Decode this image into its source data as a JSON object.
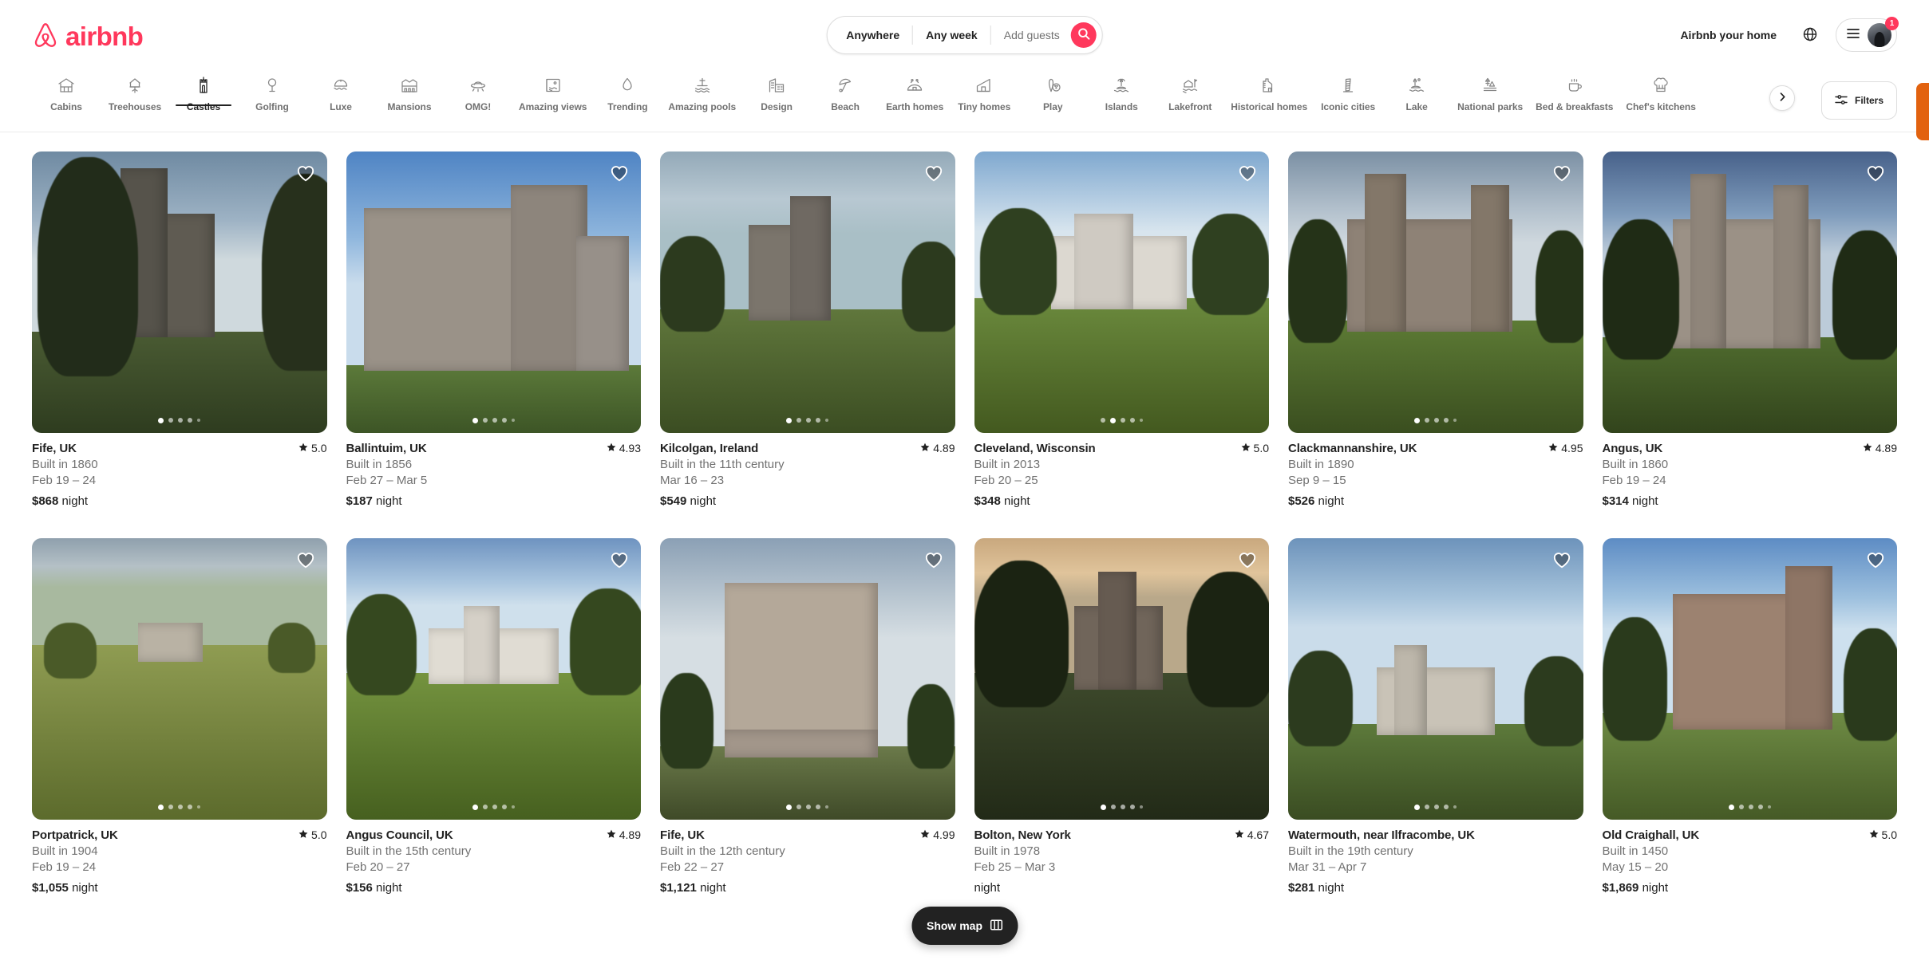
{
  "header": {
    "brand": "airbnb",
    "host_link": "Airbnb your home",
    "globe_icon": "globe-icon",
    "menu_icon": "hamburger-icon",
    "notification_count": "1",
    "search": {
      "location": "Anywhere",
      "dates": "Any week",
      "guests_placeholder": "Add guests",
      "search_icon": "search-icon"
    }
  },
  "categories": {
    "active": "Castles",
    "next_icon": "chevron-right-icon",
    "filters_label": "Filters",
    "filters_icon": "sliders-icon",
    "items": [
      {
        "label": "Cabins",
        "icon": "cabin-icon"
      },
      {
        "label": "Treehouses",
        "icon": "treehouse-icon"
      },
      {
        "label": "Castles",
        "icon": "castle-icon"
      },
      {
        "label": "Golfing",
        "icon": "golf-icon"
      },
      {
        "label": "Luxe",
        "icon": "luxe-cloche-icon"
      },
      {
        "label": "Mansions",
        "icon": "mansion-icon"
      },
      {
        "label": "OMG!",
        "icon": "ufo-icon"
      },
      {
        "label": "Amazing views",
        "icon": "amazing-views-icon"
      },
      {
        "label": "Trending",
        "icon": "flame-icon"
      },
      {
        "label": "Amazing pools",
        "icon": "pool-icon"
      },
      {
        "label": "Design",
        "icon": "design-icon"
      },
      {
        "label": "Beach",
        "icon": "beach-umbrella-icon"
      },
      {
        "label": "Earth homes",
        "icon": "earth-home-icon"
      },
      {
        "label": "Tiny homes",
        "icon": "tiny-home-icon"
      },
      {
        "label": "Play",
        "icon": "bowling-icon"
      },
      {
        "label": "Islands",
        "icon": "island-icon"
      },
      {
        "label": "Lakefront",
        "icon": "lakefront-icon"
      },
      {
        "label": "Historical homes",
        "icon": "historical-home-icon"
      },
      {
        "label": "Iconic cities",
        "icon": "leaning-tower-icon"
      },
      {
        "label": "Lake",
        "icon": "lake-icon"
      },
      {
        "label": "National parks",
        "icon": "national-park-icon"
      },
      {
        "label": "Bed & breakfasts",
        "icon": "coffee-cup-icon"
      },
      {
        "label": "Chef's kitchens",
        "icon": "chef-hat-icon"
      }
    ]
  },
  "listings": [
    {
      "title": "Fife, UK",
      "subtitle": "Built in 1860",
      "dates": "Feb 19 – 24",
      "price": "$868",
      "price_unit": "night",
      "rating": "5.0",
      "dots": 5,
      "active_dot": 0
    },
    {
      "title": "Ballintuim, UK",
      "subtitle": "Built in 1856",
      "dates": "Feb 27 – Mar 5",
      "price": "$187",
      "price_unit": "night",
      "rating": "4.93",
      "dots": 5,
      "active_dot": 0
    },
    {
      "title": "Kilcolgan, Ireland",
      "subtitle": "Built in the 11th century",
      "dates": "Mar 16 – 23",
      "price": "$549",
      "price_unit": "night",
      "rating": "4.89",
      "dots": 5,
      "active_dot": 0
    },
    {
      "title": "Cleveland, Wisconsin",
      "subtitle": "Built in 2013",
      "dates": "Feb 20 – 25",
      "price": "$348",
      "price_unit": "night",
      "rating": "5.0",
      "dots": 5,
      "active_dot": 1
    },
    {
      "title": "Clackmannanshire, UK",
      "subtitle": "Built in 1890",
      "dates": "Sep 9 – 15",
      "price": "$526",
      "price_unit": "night",
      "rating": "4.95",
      "dots": 5,
      "active_dot": 0
    },
    {
      "title": "Angus, UK",
      "subtitle": "Built in 1860",
      "dates": "Feb 19 – 24",
      "price": "$314",
      "price_unit": "night",
      "rating": "4.89",
      "dots": 0,
      "active_dot": 0
    },
    {
      "title": "Portpatrick, UK",
      "subtitle": "Built in 1904",
      "dates": "Feb 19 – 24",
      "price": "$1,055",
      "price_unit": "night",
      "rating": "5.0",
      "dots": 5,
      "active_dot": 0
    },
    {
      "title": "Angus Council, UK",
      "subtitle": "Built in the 15th century",
      "dates": "Feb 20 – 27",
      "price": "$156",
      "price_unit": "night",
      "rating": "4.89",
      "dots": 5,
      "active_dot": 0
    },
    {
      "title": "Fife, UK",
      "subtitle": "Built in the 12th century",
      "dates": "Feb 22 – 27",
      "price": "$1,121",
      "price_unit": "night",
      "rating": "4.99",
      "dots": 5,
      "active_dot": 0
    },
    {
      "title": "Bolton, New York",
      "subtitle": "Built in 1978",
      "dates": "Feb 25 – Mar 3",
      "price": "",
      "price_unit": "night",
      "rating": "4.67",
      "dots": 5,
      "active_dot": 0
    },
    {
      "title": "Watermouth, near Ilfracombe, UK",
      "subtitle": "Built in the 19th century",
      "dates": "Mar 31 – Apr 7",
      "price": "$281",
      "price_unit": "night",
      "rating": "",
      "dots": 5,
      "active_dot": 0
    },
    {
      "title": "Old Craighall, UK",
      "subtitle": "Built in 1450",
      "dates": "May 15 – 20",
      "price": "$1,869",
      "price_unit": "night",
      "rating": "5.0",
      "dots": 5,
      "active_dot": 0
    }
  ],
  "show_map": {
    "label": "Show map",
    "icon": "map-icon"
  },
  "colors": {
    "brand": "#FF385C",
    "text": "#222222",
    "muted": "#717171",
    "border": "#dddddd",
    "dark_pill": "#222222",
    "feedback_tab": "#E2620F"
  }
}
